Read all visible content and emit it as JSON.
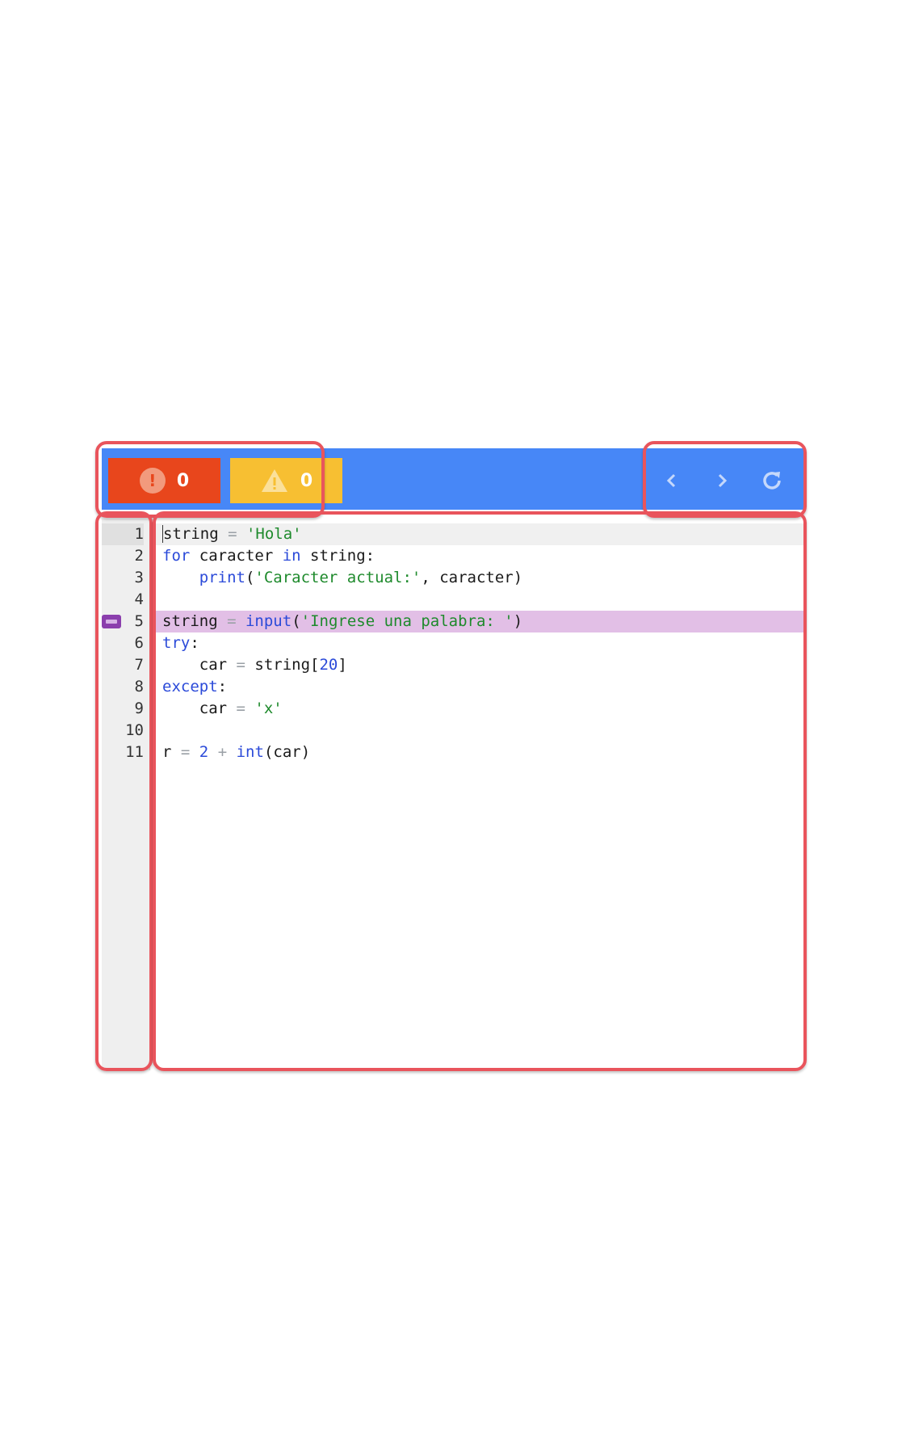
{
  "toolbar": {
    "error_count": "0",
    "warning_count": "0",
    "colors": {
      "toolbar_bg": "#4787f7",
      "error_bg": "#e8461c",
      "warning_bg": "#f7bf32"
    },
    "icons": [
      "error-icon",
      "warning-icon",
      "chevron-left-icon",
      "chevron-right-icon",
      "reload-icon"
    ]
  },
  "editor": {
    "line_numbers": [
      "1",
      "2",
      "3",
      "4",
      "5",
      "6",
      "7",
      "8",
      "9",
      "10",
      "11"
    ],
    "active_line": 1,
    "breakpoint_line": 5,
    "lines": [
      {
        "text": "string = 'Hola'",
        "tokens": [
          [
            "",
            "string "
          ],
          [
            "op",
            "="
          ],
          [
            "",
            " "
          ],
          [
            "str",
            "'Hola'"
          ]
        ]
      },
      {
        "text": "for caracter in string:",
        "tokens": [
          [
            "kw",
            "for"
          ],
          [
            "",
            " caracter "
          ],
          [
            "kw",
            "in"
          ],
          [
            "",
            " string:"
          ]
        ]
      },
      {
        "text": "    print('Caracter actual:', caracter)",
        "tokens": [
          [
            "",
            "    "
          ],
          [
            "kw",
            "print"
          ],
          [
            "",
            "("
          ],
          [
            "str",
            "'Caracter actual:'"
          ],
          [
            "",
            ", caracter)"
          ]
        ]
      },
      {
        "text": "",
        "tokens": []
      },
      {
        "text": "string = input('Ingrese una palabra: ')",
        "tokens": [
          [
            "",
            "string "
          ],
          [
            "op",
            "="
          ],
          [
            "",
            " "
          ],
          [
            "kw",
            "input"
          ],
          [
            "",
            "("
          ],
          [
            "str",
            "'Ingrese una palabra: '"
          ],
          [
            "",
            ")"
          ]
        ]
      },
      {
        "text": "try:",
        "tokens": [
          [
            "kw",
            "try"
          ],
          [
            "",
            ":"
          ]
        ]
      },
      {
        "text": "    car = string[20]",
        "tokens": [
          [
            "",
            "    car "
          ],
          [
            "op",
            "="
          ],
          [
            "",
            " string["
          ],
          [
            "num",
            "20"
          ],
          [
            "",
            "]"
          ]
        ]
      },
      {
        "text": "except:",
        "tokens": [
          [
            "kw",
            "except"
          ],
          [
            "",
            ":"
          ]
        ]
      },
      {
        "text": "    car = 'x'",
        "tokens": [
          [
            "",
            "    car "
          ],
          [
            "op",
            "="
          ],
          [
            "",
            " "
          ],
          [
            "str",
            "'x'"
          ]
        ]
      },
      {
        "text": "",
        "tokens": []
      },
      {
        "text": "r = 2 + int(car)",
        "tokens": [
          [
            "",
            "r "
          ],
          [
            "op",
            "="
          ],
          [
            "",
            " "
          ],
          [
            "num",
            "2"
          ],
          [
            "",
            " "
          ],
          [
            "op",
            "+"
          ],
          [
            "",
            " "
          ],
          [
            "kw",
            "int"
          ],
          [
            "",
            "(car)"
          ]
        ]
      }
    ]
  }
}
